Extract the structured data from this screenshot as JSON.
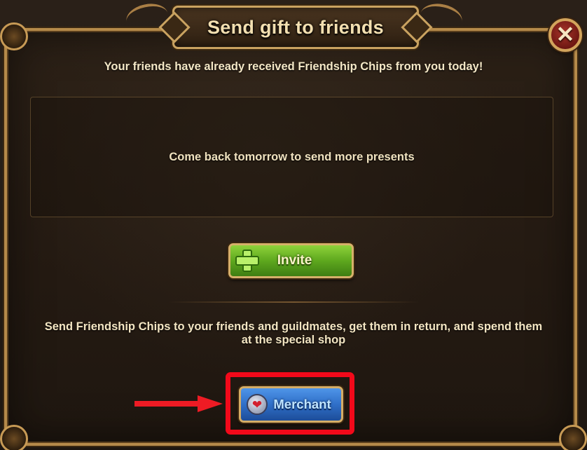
{
  "dialog": {
    "title": "Send gift to friends",
    "close_icon": "close-icon",
    "close_glyph": "✕"
  },
  "notice": "Your friends have already received Friendship Chips from you today!",
  "empty_state": "Come back tomorrow to send more presents",
  "invite_button": {
    "label": "Invite",
    "icon": "plus-icon"
  },
  "info_text": "Send Friendship Chips to your friends and guildmates, get them in return, and spend them at the special shop",
  "merchant_button": {
    "label": "Merchant",
    "icon": "heart-icon",
    "heart_glyph": "❤"
  },
  "annotation": {
    "highlight_color": "#f2091a",
    "arrow_color": "#ee1b24"
  },
  "colors": {
    "invite_green": "#5ea81e",
    "merchant_blue": "#2f6fc8",
    "frame_gold": "#b58a4a"
  }
}
